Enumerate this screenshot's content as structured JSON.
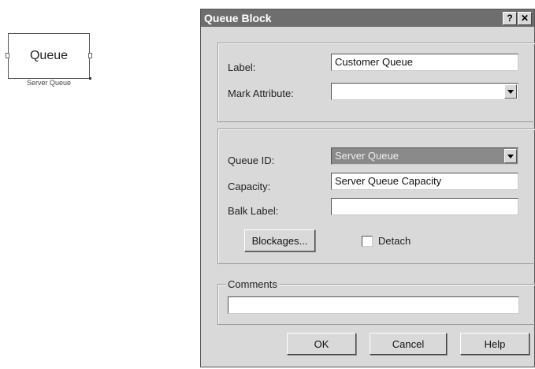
{
  "canvas": {
    "block_label": "Queue",
    "block_caption": "Server Queue"
  },
  "dialog": {
    "title": "Queue Block",
    "help_button": "?",
    "close_button": "✕",
    "general": {
      "label_caption": "Label:",
      "label_value": "Customer Queue",
      "mark_attribute_caption": "Mark Attribute:",
      "mark_attribute_value": ""
    },
    "queue": {
      "queue_id_caption": "Queue ID:",
      "queue_id_value": "Server Queue",
      "capacity_caption": "Capacity:",
      "capacity_value": "Server Queue Capacity",
      "balk_label_caption": "Balk Label:",
      "balk_label_value": "",
      "blockages_button": "Blockages...",
      "detach_label": "Detach",
      "detach_checked": false
    },
    "comments": {
      "legend": "Comments",
      "value": ""
    },
    "footer": {
      "ok": "OK",
      "cancel": "Cancel",
      "help": "Help"
    }
  }
}
